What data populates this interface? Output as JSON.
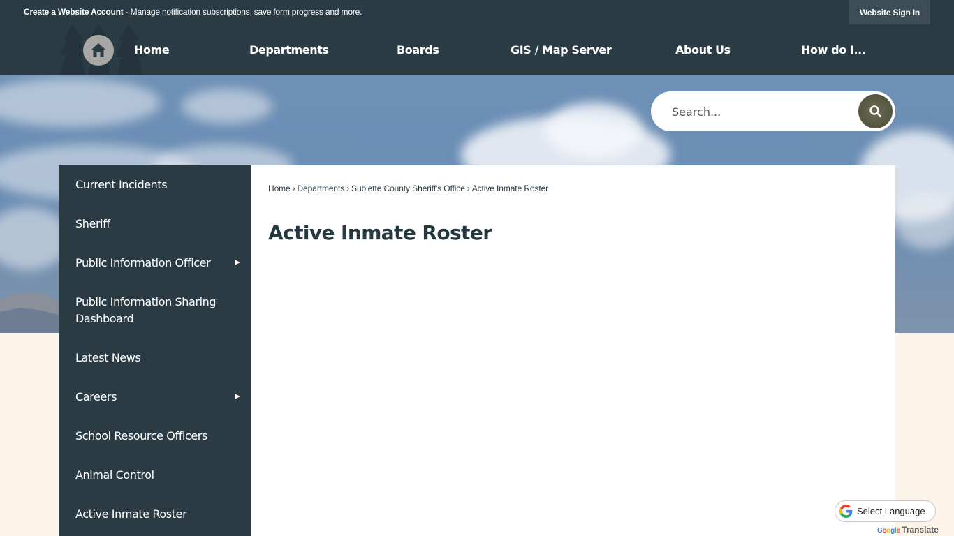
{
  "topbar": {
    "account_link": "Create a Website Account",
    "account_desc": " - Manage notification subscriptions, save form progress and more.",
    "signin_label": "Website Sign In"
  },
  "nav": {
    "home_icon": "home-icon",
    "items": [
      {
        "label": "Home"
      },
      {
        "label": "Departments"
      },
      {
        "label": "Boards"
      },
      {
        "label": "GIS / Map Server"
      },
      {
        "label": "About Us"
      },
      {
        "label": "How do I..."
      }
    ]
  },
  "search": {
    "placeholder": "Search...",
    "value": "",
    "icon": "search-icon"
  },
  "sidebar": {
    "items": [
      {
        "label": "Current Incidents",
        "has_submenu": false
      },
      {
        "label": "Sheriff",
        "has_submenu": false
      },
      {
        "label": "Public Information Officer",
        "has_submenu": true
      },
      {
        "label": "Public Information Sharing Dashboard",
        "has_submenu": false
      },
      {
        "label": "Latest News",
        "has_submenu": false
      },
      {
        "label": "Careers",
        "has_submenu": true
      },
      {
        "label": "School Resource Officers",
        "has_submenu": false
      },
      {
        "label": "Animal Control",
        "has_submenu": false
      },
      {
        "label": "Active Inmate Roster",
        "has_submenu": false
      }
    ]
  },
  "breadcrumb": {
    "items": [
      "Home",
      "Departments",
      "Sublette County Sheriff's Office",
      "Active Inmate Roster"
    ],
    "separator": "›"
  },
  "page": {
    "title": "Active Inmate Roster"
  },
  "translate": {
    "label": "Select Language",
    "powered_google": "Google",
    "powered_translate": "Translate"
  },
  "colors": {
    "primary_dark": "#2b3b44",
    "signin_bg": "#3d4d56",
    "page_bg": "#fcf4e8",
    "title": "#253842",
    "search_button": "#55563f"
  }
}
